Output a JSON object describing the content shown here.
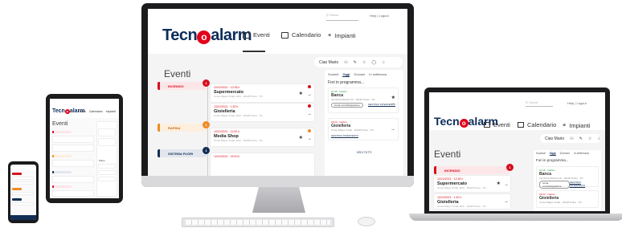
{
  "app": {
    "logo_text_a": "Tecn",
    "logo_text_o": "o",
    "logo_text_b": "alarm",
    "logo_mark": "·"
  },
  "nav": {
    "eventi": "Eventi",
    "calendario": "Calendario",
    "impianti": "Impianti"
  },
  "topbar": {
    "search_placeholder": "Cerca",
    "help": "Help",
    "logout": "Logout",
    "user_name": "Ciao Mario"
  },
  "page": {
    "title": "Eventi"
  },
  "timeline": [
    {
      "label": "INCENDIO",
      "badge": "1",
      "color": "#d6101e"
    },
    {
      "label": "RAPINA",
      "badge": "1",
      "color": "#f08a24"
    },
    {
      "label": "SISTEMA FUORI",
      "badge": "1",
      "color": "#132f55"
    }
  ],
  "events": [
    {
      "time": "10/10/2021 · 12:35 h",
      "name": "Supermercato",
      "addr": "Corso Filippo Turati, 20/C · 10128 Torino · TO"
    },
    {
      "time": "10/10/2021 · 1:30 h",
      "name": "Gioielleria",
      "addr": "Corso Filippo Turati, 20/C · 10128 Torino · TO"
    },
    {
      "time": "10/10/2021 · 11:20 h",
      "name": "Media Shop",
      "addr": "Corso Filippo Turati, 20/C · 10128 Torino · TO"
    },
    {
      "time": "10/10/2021 · 15:20 h",
      "name": ""
    }
  ],
  "panel": {
    "tabs": [
      "Scaduti",
      "Oggi",
      "Domani",
      "In settimana"
    ],
    "active_tab": "Oggi",
    "heading": "Fori in programma...",
    "items": [
      {
        "tag": "10:45 · Inattivo",
        "name": "Banca",
        "addr": "Via Nizza Mazzini 10 · 10125 Torino · TO",
        "action": "Avvia controllo/gestione",
        "link": "GESTISCI INTERVENTO"
      },
      {
        "tag": "18:00 · Inattivo",
        "name": "Gioielleria",
        "addr": "Corso Filippo Turati · 10128 Torino · TO",
        "link": "GESTISCI INTERVENTO"
      }
    ],
    "more": "VEDI TUTTI"
  },
  "laptop": {
    "timeline_label": "INCENDIO",
    "badge": "1",
    "tabs": [
      "Scaduti",
      "Oggi",
      "Domani",
      "In settimana"
    ],
    "heading": "Fori in programma..."
  },
  "tablet": {
    "title": "Eventi",
    "calendar_label": "Calendario",
    "impianti_label": "Impianti",
    "side_label": "Piano"
  },
  "colors": {
    "brand_navy": "#132f55",
    "brand_red": "#d6101e",
    "warn_orange": "#f08a24"
  }
}
